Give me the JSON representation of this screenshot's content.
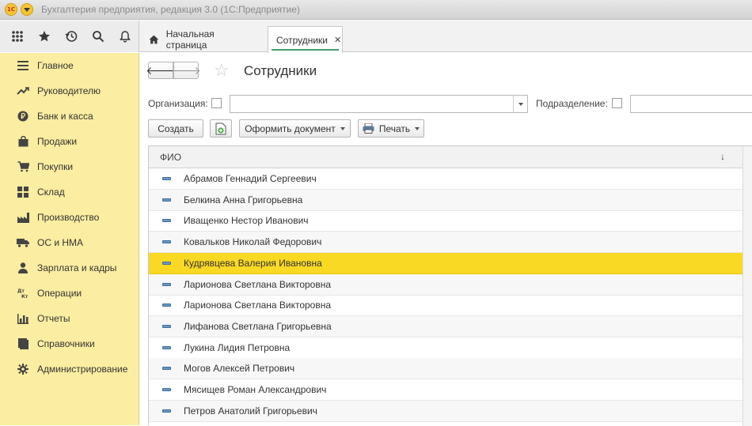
{
  "app_title": "Бухгалтерия предприятия, редакция 3.0  (1С:Предприятие)",
  "logo_text": "1С",
  "tabs": [
    {
      "label": "Начальная страница"
    },
    {
      "label": "Сотрудники"
    }
  ],
  "sidebar": {
    "items": [
      {
        "label": "Главное",
        "icon": "menu-lines-icon"
      },
      {
        "label": "Руководителю",
        "icon": "trend-up-icon"
      },
      {
        "label": "Банк и касса",
        "icon": "ruble-coin-icon"
      },
      {
        "label": "Продажи",
        "icon": "shopping-bag-icon"
      },
      {
        "label": "Покупки",
        "icon": "cart-icon"
      },
      {
        "label": "Склад",
        "icon": "warehouse-icon"
      },
      {
        "label": "Производство",
        "icon": "factory-icon"
      },
      {
        "label": "ОС и НМА",
        "icon": "truck-icon"
      },
      {
        "label": "Зарплата и кадры",
        "icon": "person-icon"
      },
      {
        "label": "Операции",
        "icon": "dt-kt-icon"
      },
      {
        "label": "Отчеты",
        "icon": "bar-chart-icon"
      },
      {
        "label": "Справочники",
        "icon": "book-icon"
      },
      {
        "label": "Администрирование",
        "icon": "gear-icon"
      }
    ],
    "background": "#fbeda1"
  },
  "page": {
    "title": "Сотрудники",
    "filters": {
      "org_label": "Организация:",
      "org_value": "",
      "dept_label": "Подразделение:",
      "dept_value": ""
    },
    "buttons": {
      "create": "Создать",
      "make_document": "Оформить документ",
      "print": "Печать"
    }
  },
  "table": {
    "column": "ФИО",
    "rows": [
      "Абрамов Геннадий Сергеевич",
      "Белкина Анна Григорьевна",
      "Иващенко Нестор Иванович",
      "Ковальков Николай Федорович",
      "Кудрявцева Валерия Ивановна",
      "Ларионова Светлана Викторовна",
      "Ларионова Светлана Викторовна",
      "Лифанова Светлана Григорьевна",
      "Лукина Лидия Петровна",
      "Могов Алексей Петрович",
      "Мясищев Роман Александрович",
      "Петров Анатолий Григорьевич"
    ],
    "selected_index": 4,
    "selected_color": "#f9d924"
  }
}
